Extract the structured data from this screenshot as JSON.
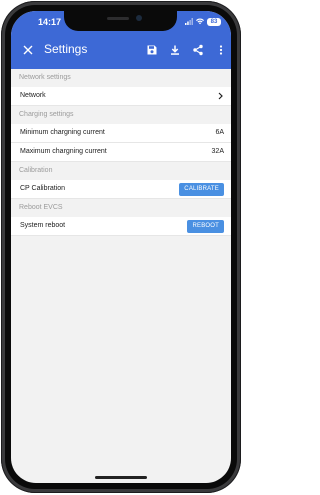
{
  "status_bar": {
    "time": "14:17",
    "battery": "83"
  },
  "toolbar": {
    "title": "Settings"
  },
  "icons": {
    "close": "close-icon",
    "save": "save-icon",
    "download": "download-icon",
    "share": "share-icon",
    "more": "more-vert-icon",
    "chevron": "chevron-right-icon"
  },
  "sections": {
    "network": {
      "header": "Network settings",
      "item_label": "Network"
    },
    "charging": {
      "header": "Charging settings",
      "min_label": "Minimum chargning current",
      "min_value": "6A",
      "max_label": "Maximum chargning current",
      "max_value": "32A"
    },
    "calibration": {
      "header": "Calibration",
      "item_label": "CP Calibration",
      "button_label": "CALIBRATE"
    },
    "reboot": {
      "header": "Reboot EVCS",
      "item_label": "System reboot",
      "button_label": "REBOOT"
    }
  },
  "colors": {
    "app_bar": "#3d69d6",
    "action_button": "#4a90e2",
    "background": "#f2f2f2"
  }
}
